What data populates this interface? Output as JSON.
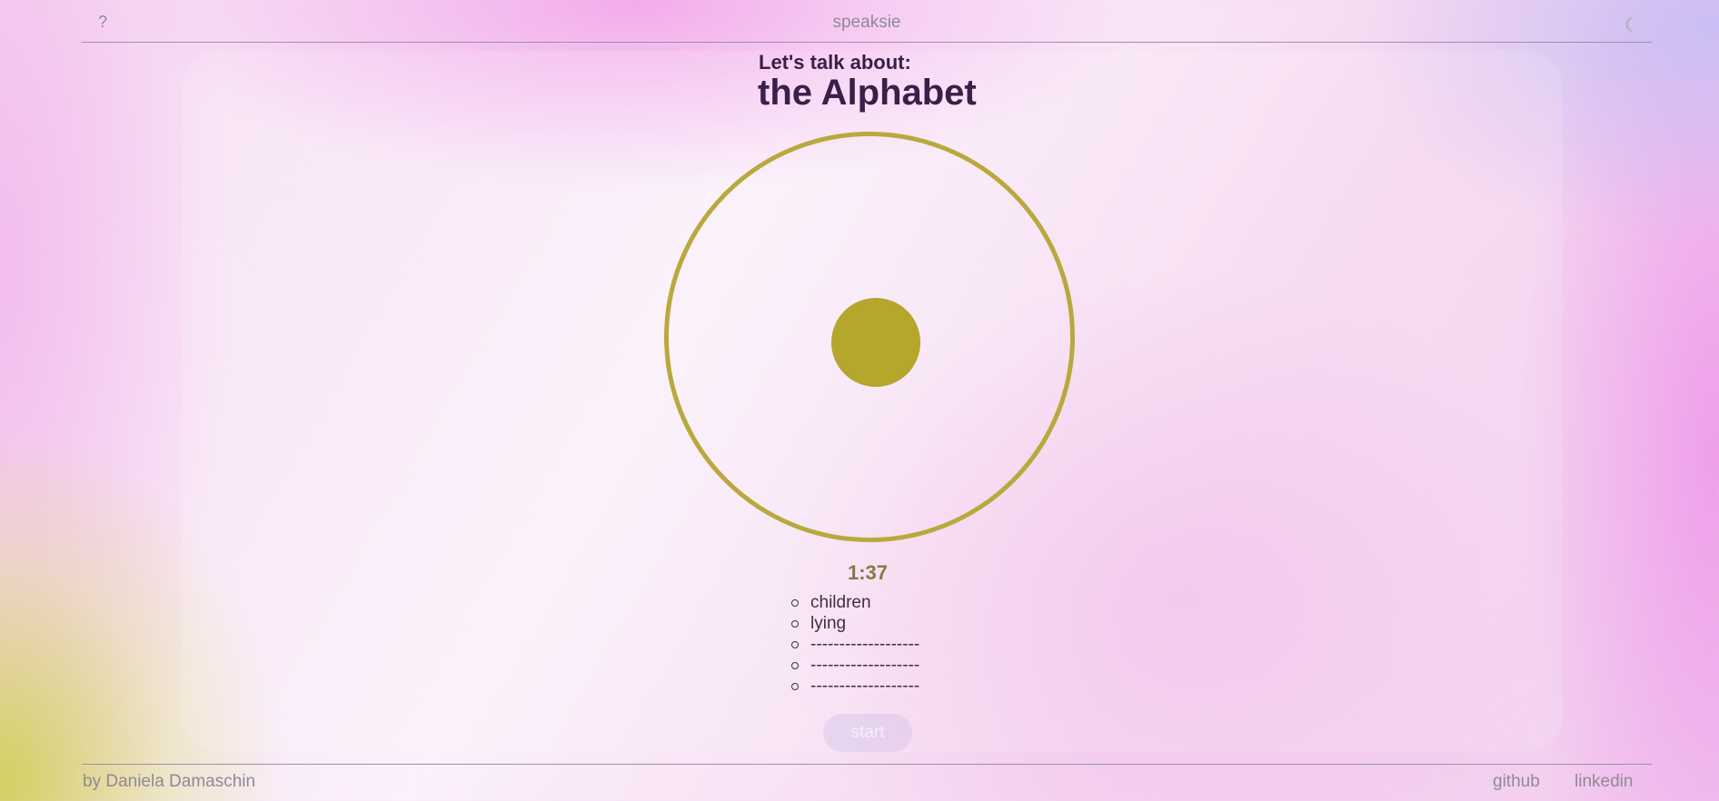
{
  "header": {
    "help_label": "?",
    "title": "speaksie",
    "theme_icon": "moon-icon"
  },
  "topic": {
    "intro": "Let's talk about:",
    "title": "the Alphabet"
  },
  "recorder": {
    "timer": "1:37",
    "ring_color": "#b9a93d",
    "dot_color": "#b5a62c"
  },
  "words": [
    "children",
    "lying",
    "-------------------",
    "-------------------",
    "-------------------"
  ],
  "start_label": "start",
  "footer": {
    "author": "by Daniela Damaschin",
    "links": [
      "github",
      "linkedin"
    ]
  }
}
